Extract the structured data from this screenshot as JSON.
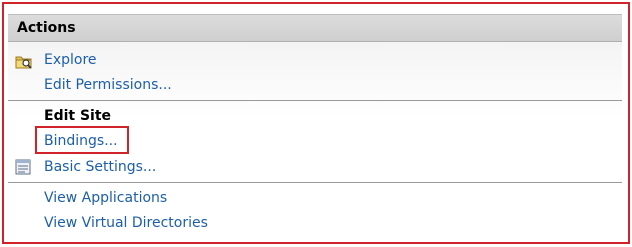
{
  "panel": {
    "title": "Actions"
  },
  "groups": [
    {
      "items": [
        {
          "label": "Explore",
          "icon": "explore-folder-icon"
        },
        {
          "label": "Edit Permissions..."
        }
      ]
    },
    {
      "heading": "Edit Site",
      "items": [
        {
          "label": "Bindings...",
          "highlighted": true
        },
        {
          "label": "Basic Settings...",
          "icon": "basic-settings-icon"
        }
      ]
    },
    {
      "items": [
        {
          "label": "View Applications"
        },
        {
          "label": "View Virtual Directories"
        }
      ]
    }
  ],
  "colors": {
    "link": "#1c5fa8",
    "highlight_border": "#d0242a",
    "header_bg": "#d6d6d6"
  }
}
